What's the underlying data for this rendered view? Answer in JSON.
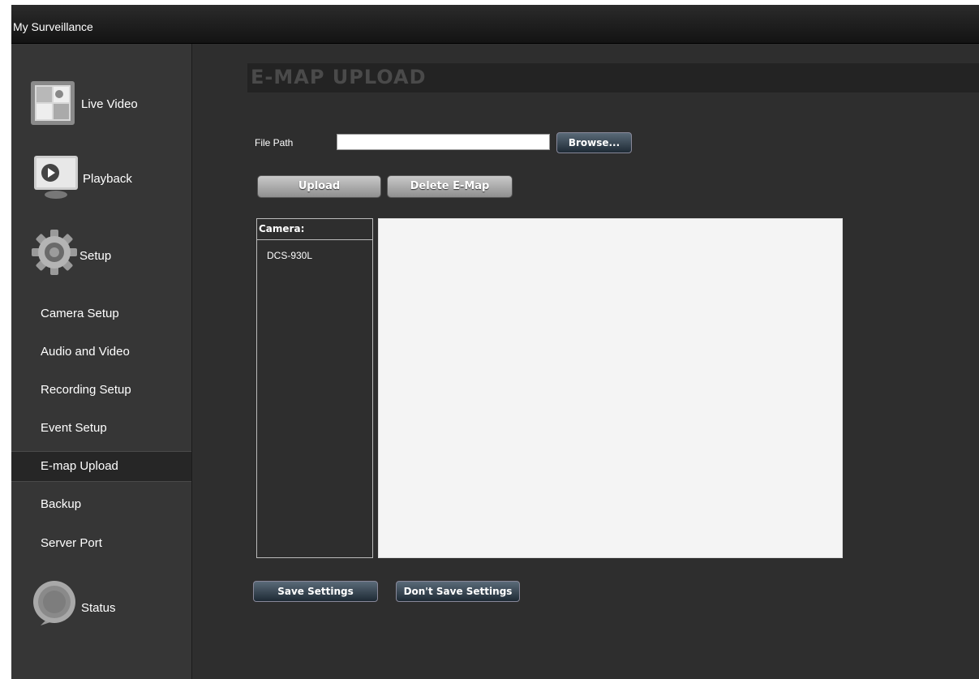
{
  "window": {
    "title": "My Surveillance"
  },
  "sidebar": {
    "main_items": [
      {
        "label": "Live Video",
        "icon": "live-video-icon"
      },
      {
        "label": "Playback",
        "icon": "playback-icon"
      },
      {
        "label": "Setup",
        "icon": "gear-icon"
      },
      {
        "label": "Status",
        "icon": "status-icon"
      }
    ],
    "sub_items": [
      {
        "label": "Camera Setup"
      },
      {
        "label": "Audio and Video"
      },
      {
        "label": "Recording Setup"
      },
      {
        "label": "Event Setup"
      },
      {
        "label": "E-map Upload",
        "active": true
      },
      {
        "label": "Backup"
      },
      {
        "label": "Server Port"
      }
    ]
  },
  "main": {
    "heading": "E-MAP UPLOAD",
    "file_path_label": "File Path",
    "file_path_value": "",
    "browse_label": "Browse...",
    "upload_label": "Upload",
    "delete_label": "Delete E-Map",
    "camera_header": "Camera:",
    "cameras": [
      "DCS-930L"
    ],
    "save_label": "Save Settings",
    "dont_save_label": "Don't Save Settings"
  },
  "colors": {
    "background": "#2e2e2e",
    "sidebar": "#363636",
    "titlebar": "#131313",
    "map_area": "#f4f4f4"
  }
}
